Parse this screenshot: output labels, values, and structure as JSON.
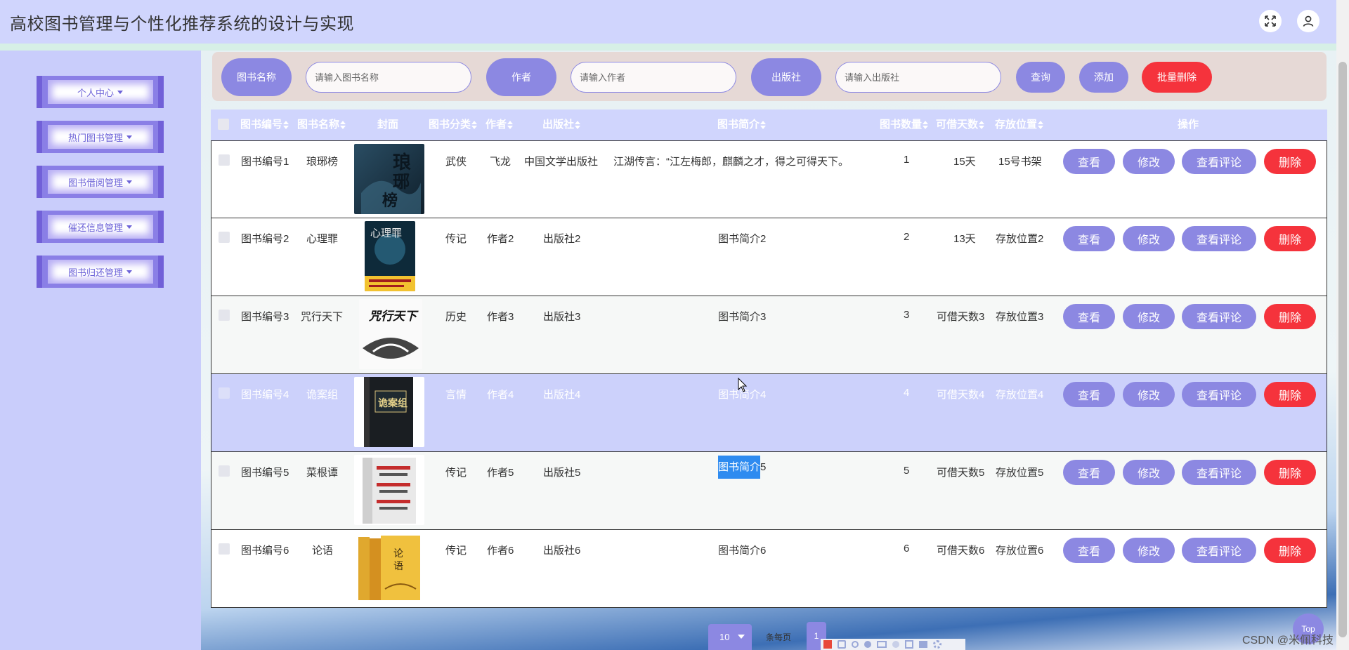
{
  "app": {
    "title": "高校图书管理与个性化推荐系统的设计与实现"
  },
  "header": {
    "fullscreen_icon": "fullscreen-icon",
    "user_icon": "user-icon"
  },
  "sidebar": {
    "items": [
      {
        "label": "个人中心"
      },
      {
        "label": "热门图书管理"
      },
      {
        "label": "图书借阅管理"
      },
      {
        "label": "催还信息管理"
      },
      {
        "label": "图书归还管理"
      }
    ]
  },
  "search": {
    "title_label": "图书名称",
    "title_placeholder": "请输入图书名称",
    "author_label": "作者",
    "author_placeholder": "请输入作者",
    "publisher_label": "出版社",
    "publisher_placeholder": "请输入出版社",
    "query_button": "查询",
    "add_button": "添加",
    "batch_delete_button": "批量删除"
  },
  "table": {
    "headers": {
      "code": "图书编号",
      "name": "图书名称",
      "cover": "封面",
      "category": "图书分类",
      "author": "作者",
      "publisher": "出版社",
      "intro": "图书简介",
      "count": "图书数量",
      "days": "可借天数",
      "location": "存放位置",
      "ops": "操作"
    },
    "actions": {
      "view": "查看",
      "edit": "修改",
      "comments": "查看评论",
      "delete": "删除"
    },
    "rows": [
      {
        "code": "图书编号1",
        "name": "琅琊榜",
        "category": "武侠",
        "author": "飞龙",
        "publisher": "中国文学出版社",
        "intro": "江湖传言：“江左梅郎，麒麟之才，得之可得天下。",
        "count": "1",
        "days": "15天",
        "location": "15号书架",
        "cover_title": "琅琊榜"
      },
      {
        "code": "图书编号2",
        "name": "心理罪",
        "category": "传记",
        "author": "作者2",
        "publisher": "出版社2",
        "intro": "图书简介2",
        "count": "2",
        "days": "13天",
        "location": "存放位置2",
        "cover_title": "心理罪"
      },
      {
        "code": "图书编号3",
        "name": "咒行天下",
        "category": "历史",
        "author": "作者3",
        "publisher": "出版社3",
        "intro": "图书简介3",
        "count": "3",
        "days": "可借天数3",
        "location": "存放位置3",
        "cover_title": "咒行天下"
      },
      {
        "code": "图书编号4",
        "name": "诡案组",
        "category": "言情",
        "author": "作者4",
        "publisher": "出版社4",
        "intro": "图书简介4",
        "count": "4",
        "days": "可借天数4",
        "location": "存放位置4",
        "cover_title": "诡案组"
      },
      {
        "code": "图书编号5",
        "name": "菜根谭",
        "category": "传记",
        "author": "作者5",
        "publisher": "出版社5",
        "intro_selected": "图书简介",
        "intro_rest": "5",
        "count": "5",
        "days": "可借天数5",
        "location": "存放位置5"
      },
      {
        "code": "图书编号6",
        "name": "论语",
        "category": "传记",
        "author": "作者6",
        "publisher": "出版社6",
        "intro": "图书简介6",
        "count": "6",
        "days": "可借天数6",
        "location": "存放位置6",
        "cover_title": "论语"
      }
    ]
  },
  "pagination": {
    "page_size": "10",
    "per_page_text": "条每页",
    "current_page": "1"
  },
  "top_button": "Top",
  "watermark": "CSDN @米佩科技",
  "colors": {
    "accent": "#8c88e2",
    "danger": "#f5333c",
    "header_bg": "#d0d5fd",
    "sidebar_bg": "#c9cdfb"
  }
}
